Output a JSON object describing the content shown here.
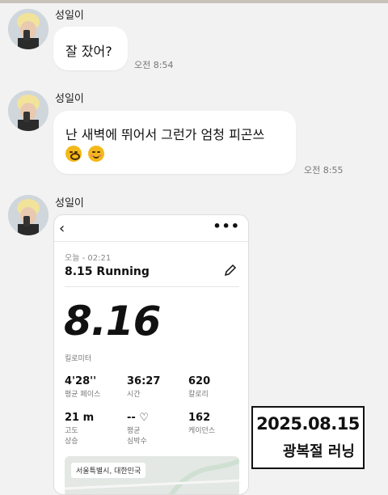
{
  "messages": [
    {
      "sender": "성일이",
      "text": "잘 잤어?",
      "time": "오전 8:54"
    },
    {
      "sender": "성일이",
      "text": "난 새벽에 뛰어서 그런가 엄청 피곤쓰",
      "emojis": [
        "yawning-face-emoji",
        "flushed-face-emoji"
      ],
      "time": "오전 8:55"
    },
    {
      "sender": "성일이"
    }
  ],
  "run_screenshot": {
    "date_label": "오늘 - 02:21",
    "title": "8.15 Running",
    "distance": "8.16",
    "distance_unit": "킬로미터",
    "stats": [
      {
        "value": "4'28''",
        "label": "평균 페이스"
      },
      {
        "value": "36:27",
        "label": "시간"
      },
      {
        "value": "620",
        "label": "칼로리"
      },
      {
        "value": "21 m",
        "label": "고도\n상승"
      },
      {
        "value": "-- ♡",
        "label": "평균\n심박수"
      },
      {
        "value": "162",
        "label": "케이던스"
      }
    ],
    "map_label": "서울특별시, 대한민국"
  },
  "stamp": {
    "date": "2025.08.15",
    "caption": "광복절 러닝"
  },
  "colors": {
    "background": "#f2f2f2",
    "bubble": "#ffffff",
    "emoji": "#f3b91a",
    "top_line": "#c9c2b8"
  }
}
